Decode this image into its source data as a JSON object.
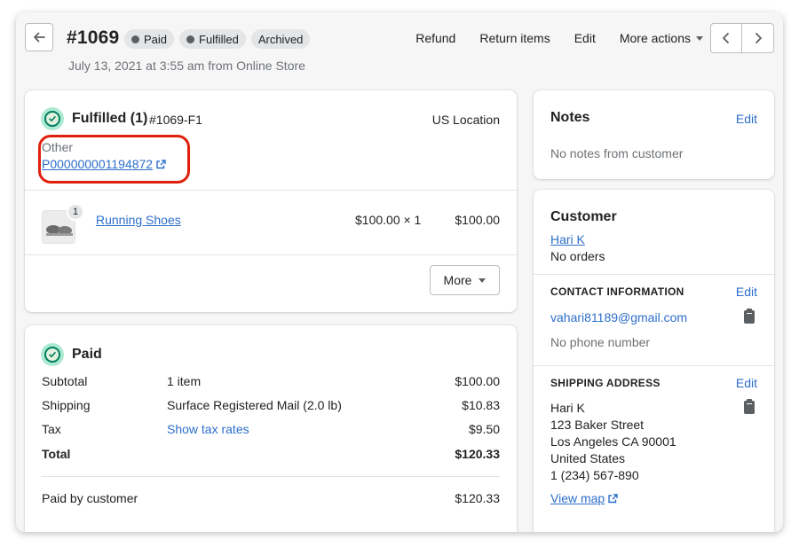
{
  "header": {
    "order_number": "#1069",
    "badges": [
      {
        "label": "Paid",
        "dot": true
      },
      {
        "label": "Fulfilled",
        "dot": true
      },
      {
        "label": "Archived",
        "dot": false
      }
    ],
    "meta": "July 13, 2021 at 3:55 am from Online Store",
    "actions": {
      "refund": "Refund",
      "return_items": "Return items",
      "edit": "Edit",
      "more_actions": "More actions"
    }
  },
  "fulfillment": {
    "title": "Fulfilled (1)",
    "fulfillment_id": "#1069-F1",
    "location": "US Location",
    "carrier_label": "Other",
    "tracking_number": "P000000001194872",
    "item": {
      "name": "Running Shoes",
      "quantity_badge": "1",
      "unit_price": "$100.00 × 1",
      "total": "$100.00"
    },
    "more_button": "More"
  },
  "payment": {
    "title": "Paid",
    "rows": [
      {
        "label": "Subtotal",
        "detail": "1 item",
        "amount": "$100.00"
      },
      {
        "label": "Shipping",
        "detail": "Surface Registered Mail (2.0 lb)",
        "amount": "$10.83"
      },
      {
        "label": "Tax",
        "detail": "Show tax rates",
        "amount": "$9.50"
      },
      {
        "label": "Total",
        "detail": "",
        "amount": "$120.33"
      }
    ],
    "paid_by_label": "Paid by customer",
    "paid_by_amount": "$120.33"
  },
  "notes": {
    "title": "Notes",
    "edit": "Edit",
    "text": "No notes from customer"
  },
  "customer": {
    "title": "Customer",
    "name": "Hari K",
    "orders": "No orders",
    "contact": {
      "heading": "CONTACT INFORMATION",
      "edit": "Edit",
      "email": "vahari81189@gmail.com",
      "phone": "No phone number"
    },
    "shipping": {
      "heading": "SHIPPING ADDRESS",
      "edit": "Edit",
      "lines": [
        "Hari K",
        "123 Baker Street",
        "Los Angeles CA 90001",
        "United States",
        "1 (234) 567-890"
      ],
      "view_map": "View map"
    }
  },
  "colors": {
    "link": "#2c6ecb",
    "success": "#007f5f",
    "highlight": "#e0200d"
  }
}
